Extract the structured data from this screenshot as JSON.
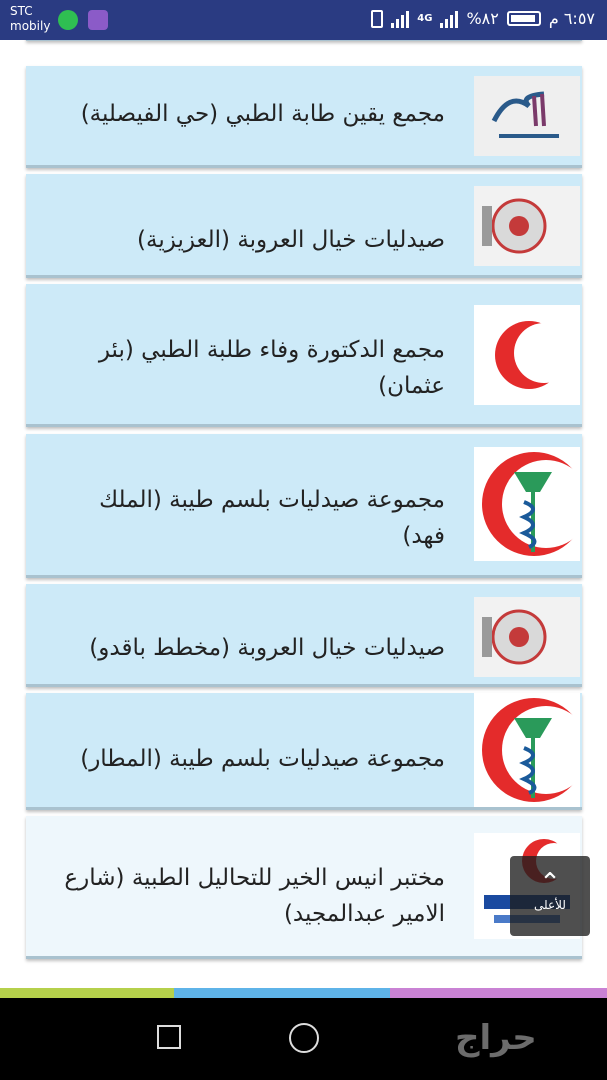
{
  "status_bar": {
    "carrier_line1": "STC",
    "carrier_line2": "mobily",
    "network": "4G",
    "battery": "%٨٢",
    "time": "٦:٥٧ م"
  },
  "listings": [
    {
      "title": "مجمع يقين طابة الطبي (حي الفيصلية)",
      "logo_icon": "yaqeen-logo-icon"
    },
    {
      "title": "صيدليات خيال العروبة (العزيزية)",
      "logo_icon": "khayal-alorouba-logo-icon"
    },
    {
      "title": "مجمع الدكتورة وفاء طلبة الطبي (بئر عثمان)",
      "logo_icon": "red-crescent-icon"
    },
    {
      "title": "مجموعة صيدليات بلسم طيبة (الملك فهد)",
      "logo_icon": "pharmacy-snake-crescent-icon"
    },
    {
      "title": "صيدليات خيال العروبة (مخطط باقدو)",
      "logo_icon": "khayal-alorouba-logo-icon"
    },
    {
      "title": "مجموعة صيدليات بلسم طيبة (المطار)",
      "logo_icon": "pharmacy-snake-crescent-icon"
    },
    {
      "title": "مختبر انيس الخير للتحاليل الطبية (شارع الامير عبدالمجيد)",
      "logo_icon": "anees-alkhair-lab-logo-icon"
    }
  ],
  "back_to_top": {
    "label": "للأعلى",
    "icon": "chevron-up-icon"
  },
  "colors": {
    "status_bar": "#2a3b82",
    "card_bg": "#cdeaf8",
    "strip": [
      "#b5d04b",
      "#5eb3e8",
      "#c982d4"
    ]
  },
  "watermark": "حراج"
}
